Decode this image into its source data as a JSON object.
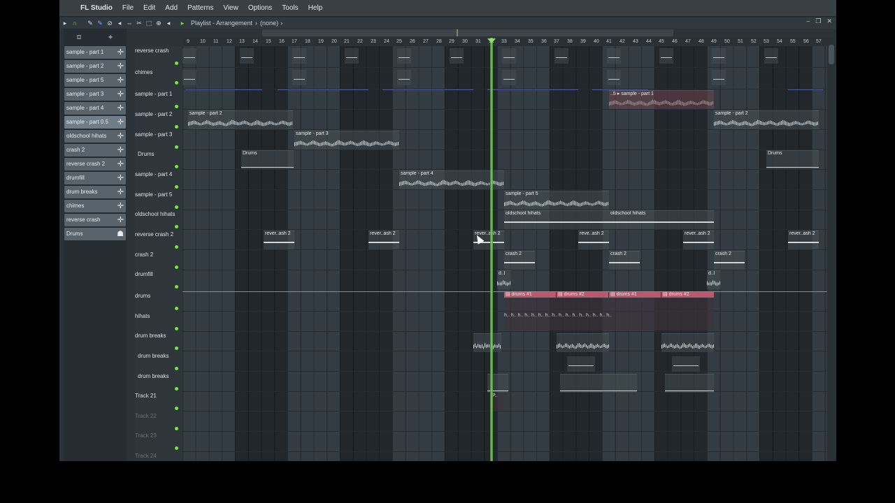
{
  "menubar": {
    "app_name": "FL Studio",
    "menus": [
      "File",
      "Edit",
      "Add",
      "Patterns",
      "View",
      "Options",
      "Tools",
      "Help"
    ]
  },
  "toolbar": {
    "title": "Playlist - Arrangement",
    "breadcrumb_sep": "›",
    "pattern": "(none)",
    "pattern_arrow": "›"
  },
  "picker": {
    "items": [
      "sample - part 1",
      "sample - part 2",
      "sample - part 5",
      "sample - part 3",
      "sample - part 4",
      "sample - part 0.5",
      "oldschool hihats",
      "crash 2",
      "reverse crash 2",
      "drumfill",
      "drum breaks",
      "chimes",
      "reverse crash",
      "Drums"
    ],
    "selected_index": 5
  },
  "tracks": [
    "reverse crash",
    "chimes",
    "sample - part 1",
    "sample - part 2",
    "sample - part 3",
    "Drums",
    "sample - part 4",
    "sample - part 5",
    "oldschool hihats",
    "reverse crash 2",
    "crash 2",
    "drumfill",
    "drums",
    "hihats",
    "drum breaks",
    "drum breaks",
    "drum breaks",
    "Track 21",
    "Track 22",
    "Track 23",
    "Track 24"
  ],
  "ruler": [
    "9",
    "10",
    "11",
    "12",
    "13",
    "14",
    "15",
    "16",
    "17",
    "18",
    "19",
    "20",
    "21",
    "22",
    "23",
    "24",
    "25",
    "26",
    "27",
    "28",
    "29",
    "30",
    "31",
    "32",
    "33",
    "34",
    "35",
    "36",
    "37",
    "38",
    "39",
    "40",
    "41",
    "42",
    "43",
    "44",
    "45",
    "46",
    "47",
    "48",
    "49",
    "50",
    "51",
    "52",
    "53",
    "54",
    "55",
    "56",
    "57"
  ],
  "clips": {
    "sample_part_2": "sample - part 2",
    "sample_part_3": "sample - part 3",
    "sample_part_4": "sample - part 4",
    "sample_part_5": "sample - part 5",
    "sample_part_1": "sample - part 1",
    "sample_part_1_short": "..5",
    "drums": "Drums",
    "oldschool_hihats": "oldschool hihats",
    "rev_ash_2": "rever..ash 2",
    "rev_ash_2b": "reve..ash 2",
    "crash_2": "crash 2",
    "drumfill_short": "d..l",
    "drums_1": "drums #1",
    "drums_2": "drums #2",
    "hihat_short": "h..",
    "track21_short": "P.."
  },
  "colors": {
    "accent_green": "#7de33e",
    "pattern_pink": "#b75a6e",
    "waveform_red": "#ff6c7d"
  }
}
